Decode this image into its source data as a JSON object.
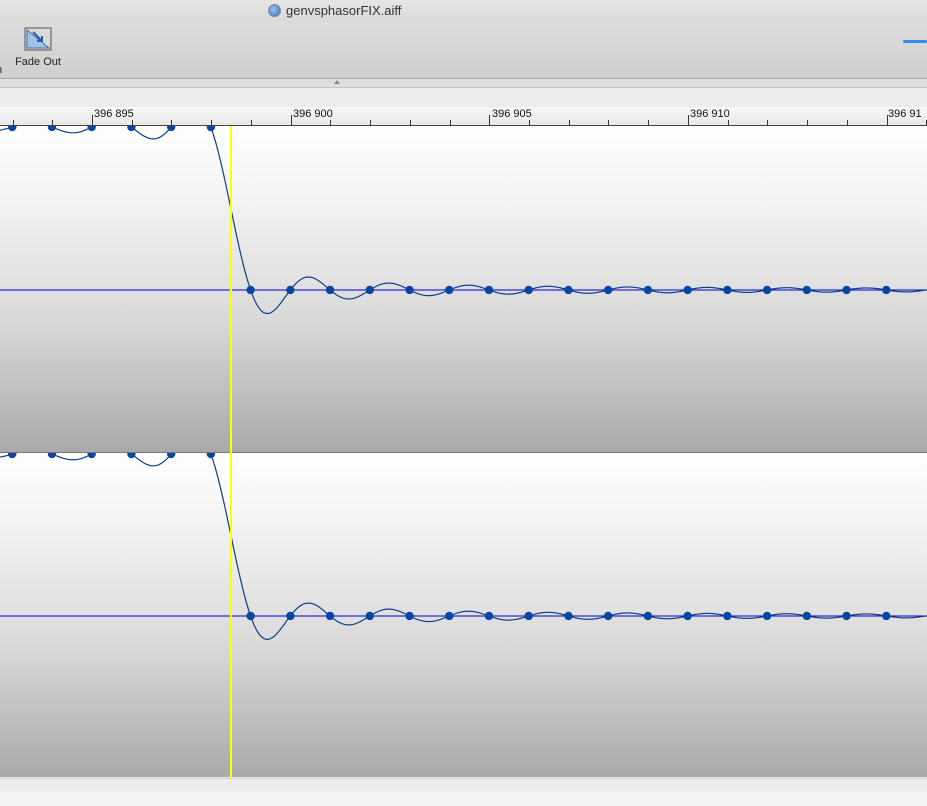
{
  "window": {
    "title": "genvsphasorFIX.aiff",
    "doc_icon": "audio-document-icon"
  },
  "toolbar": {
    "left_partial_label": "n",
    "fade_out_label": "Fade Out",
    "fade_out_icon": "fade-out-icon"
  },
  "ruler": {
    "labels": [
      "396 895",
      "396 900",
      "396 905",
      "396 910",
      "396 91"
    ]
  },
  "colors": {
    "waveform": "#0d3f86",
    "sample_dot": "#0a45a3",
    "zero_line": "#0000c8",
    "playhead": "#ffff00",
    "toolbar_accent": "#2f8ff0"
  },
  "waveform": {
    "samples": [
      -1,
      -1,
      -1,
      -1,
      -1,
      -1,
      -1,
      0,
      0,
      0,
      0,
      0,
      0,
      0,
      0,
      0,
      0,
      0,
      0,
      0,
      0,
      0,
      0,
      0
    ]
  }
}
